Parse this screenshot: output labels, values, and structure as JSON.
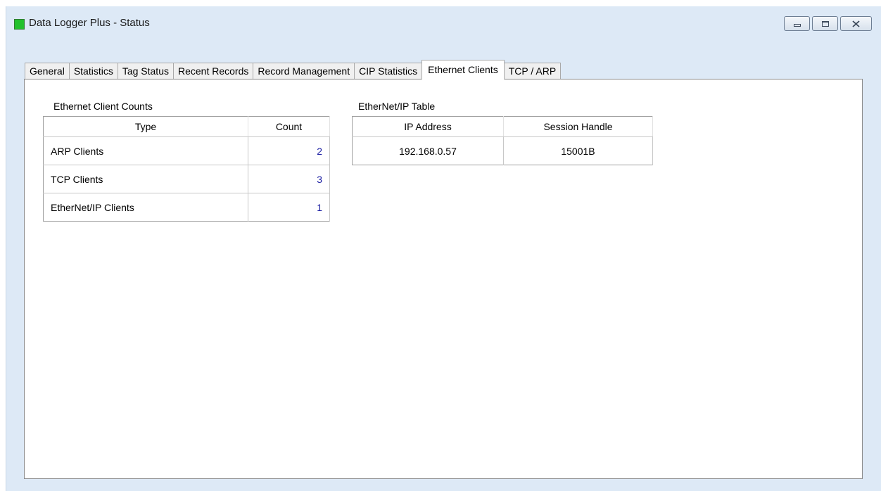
{
  "window": {
    "title": "Data Logger Plus - Status",
    "icon_color": "#22c12c"
  },
  "tabs": [
    {
      "label": "General"
    },
    {
      "label": "Statistics"
    },
    {
      "label": "Tag Status"
    },
    {
      "label": "Recent Records"
    },
    {
      "label": "Record Management"
    },
    {
      "label": "CIP Statistics"
    },
    {
      "label": "Ethernet Clients",
      "active": true
    },
    {
      "label": "TCP / ARP"
    }
  ],
  "client_counts": {
    "label": "Ethernet Client Counts",
    "columns": [
      "Type",
      "Count"
    ],
    "rows": [
      {
        "type": "ARP Clients",
        "count": "2"
      },
      {
        "type": "TCP Clients",
        "count": "3"
      },
      {
        "type": "EtherNet/IP Clients",
        "count": "1"
      }
    ]
  },
  "enip_table": {
    "label": "EtherNet/IP Table",
    "columns": [
      "IP Address",
      "Session Handle"
    ],
    "rows": [
      {
        "ip": "192.168.0.57",
        "session": "15001B"
      }
    ]
  }
}
